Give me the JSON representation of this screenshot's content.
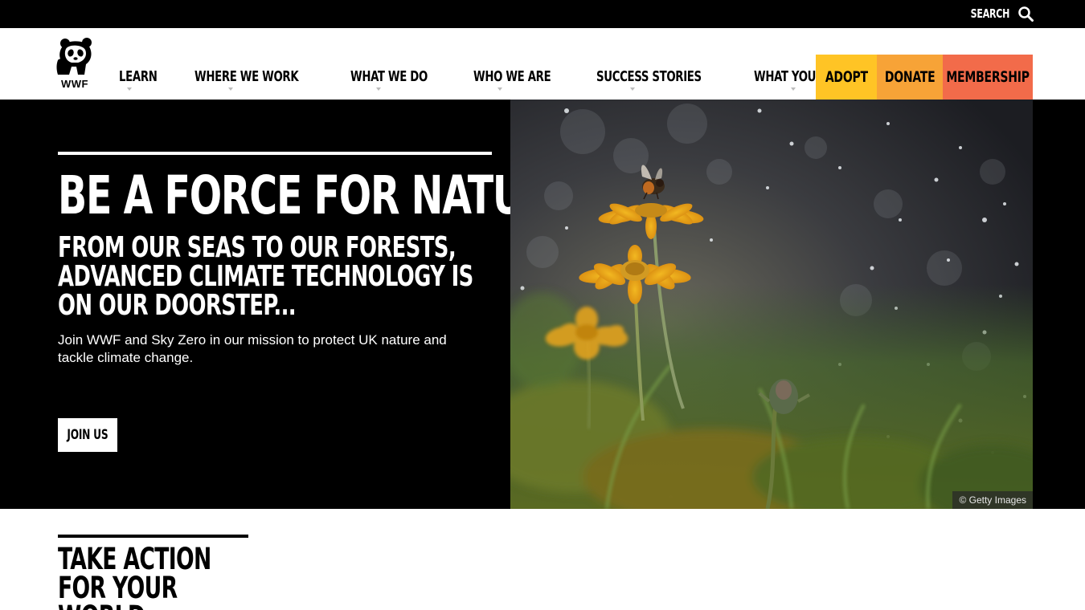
{
  "topbar": {
    "search_label": "SEARCH",
    "search_icon": "search-icon"
  },
  "header": {
    "logo_text": "WWF",
    "logo_icon": "panda-logo-icon",
    "nav": [
      {
        "label": "LEARN"
      },
      {
        "label": "WHERE WE WORK"
      },
      {
        "label": "WHAT WE DO"
      },
      {
        "label": "WHO WE ARE"
      },
      {
        "label": "SUCCESS STORIES"
      },
      {
        "label": "WHAT YOU CAN DO"
      }
    ],
    "cta": {
      "adopt": "ADOPT",
      "donate": "DONATE",
      "membership": "MEMBERSHIP"
    }
  },
  "hero": {
    "title": "BE A FORCE FOR NATURE",
    "subtitle": "FROM OUR SEAS TO OUR FORESTS, ADVANCED CLIMATE TECHNOLOGY IS ON OUR DOORSTEP...",
    "body": "Join WWF and Sky Zero in our mission to protect UK nature and tackle climate change.",
    "button_label": "JOIN US",
    "image_credit": "© Getty Images"
  },
  "action": {
    "title": "TAKE ACTION FOR YOUR WORLD"
  },
  "colors": {
    "adopt": "#ffc425",
    "donate": "#f7a337",
    "membership": "#f26b4a",
    "hero_bg": "#000000"
  }
}
